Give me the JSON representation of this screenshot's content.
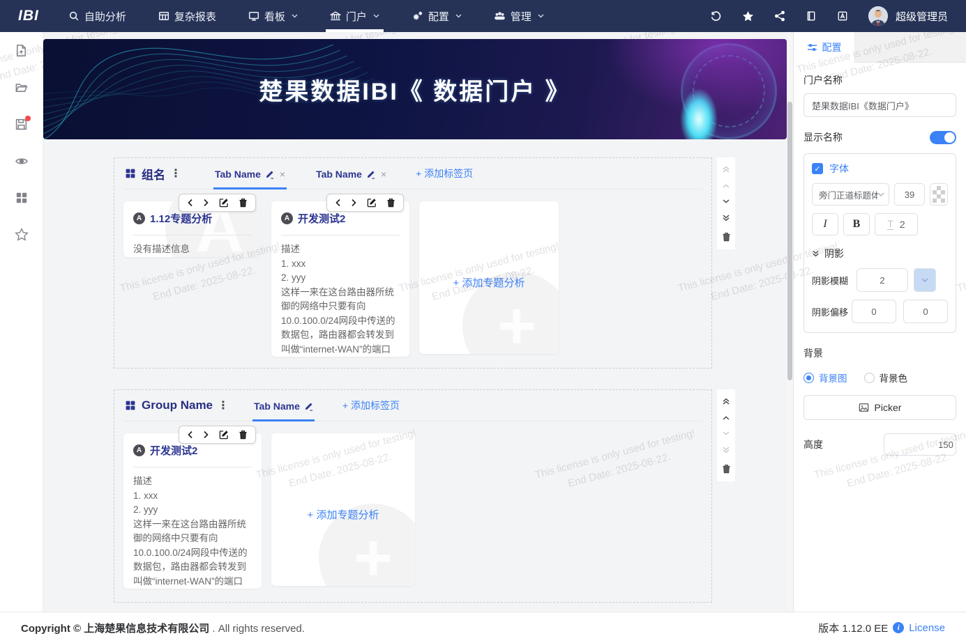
{
  "colors": {
    "accent": "#3b82f6",
    "navbar": "#263357",
    "title_indigo": "#2c3590"
  },
  "topbar": {
    "logo": "IBI",
    "menu": [
      {
        "label": "自助分析"
      },
      {
        "label": "复杂报表"
      },
      {
        "label": "看板"
      },
      {
        "label": "门户"
      },
      {
        "label": "配置"
      },
      {
        "label": "管理"
      }
    ],
    "right_icons": [
      "history",
      "favorite-star",
      "share",
      "docs-book",
      "translate-doc"
    ],
    "user": "超级管理员"
  },
  "sidebar": {
    "icons": [
      "new-file",
      "open-folder",
      "save",
      "preview-eye",
      "grid-layout",
      "favorite-star"
    ]
  },
  "banner": {
    "title": "楚果数据IBI《 数据门户 》"
  },
  "groups": [
    {
      "name": "组名",
      "tabs": [
        {
          "label": "Tab Name"
        },
        {
          "label": "Tab Name"
        }
      ],
      "add_tab": "+ 添加标签页",
      "cards": [
        {
          "title": "1.12专题分析",
          "body": "没有描述信息"
        },
        {
          "title": "开发测试2",
          "body": "描述\n1. xxx\n2. yyy\n这样一来在这台路由器所统御的网络中只要有向10.0.100.0/24网段中传送的数据包，路由器都会转发到叫做“internet-WAN”的端口"
        }
      ],
      "add_card": "+ 添加专题分析"
    },
    {
      "name": "Group Name",
      "tabs": [
        {
          "label": "Tab Name"
        }
      ],
      "add_tab": "+ 添加标签页",
      "cards": [
        {
          "title": "开发测试2",
          "body": "描述\n1. xxx\n2. yyy\n这样一来在这台路由器所统御的网络中只要有向10.0.100.0/24网段中传送的数据包，路由器都会转发到叫做“internet-WAN”的端口"
        }
      ],
      "add_card": "+ 添加专题分析"
    }
  ],
  "panel": {
    "tab": "配置",
    "portal_name_label": "门户名称",
    "portal_name_value": "楚果数据IBI《数据门户》",
    "display_name_label": "显示名称",
    "font": {
      "label": "字体",
      "family": "旁门正道标题体",
      "size": "39",
      "italic": "I",
      "bold": "B",
      "underline": "T",
      "stroke": "2"
    },
    "shadow": {
      "label": "阴影",
      "blur_label": "阴影模糊",
      "blur": "2",
      "offset_label": "阴影偏移",
      "offset_x": "0",
      "offset_y": "0"
    },
    "background": {
      "label": "背景",
      "image_option": "背景图",
      "color_option": "背景色",
      "picker": "Picker"
    },
    "height_label": "高度",
    "height_value": "150"
  },
  "footer": {
    "copyright": "Copyright © 上海楚果信息技术有限公司",
    "rights": " . All rights reserved.",
    "version": "版本 1.12.0 EE",
    "license": "License"
  },
  "watermark": {
    "line1": "This license is only used for testing!",
    "line2": "End Date: 2025-08-22."
  }
}
